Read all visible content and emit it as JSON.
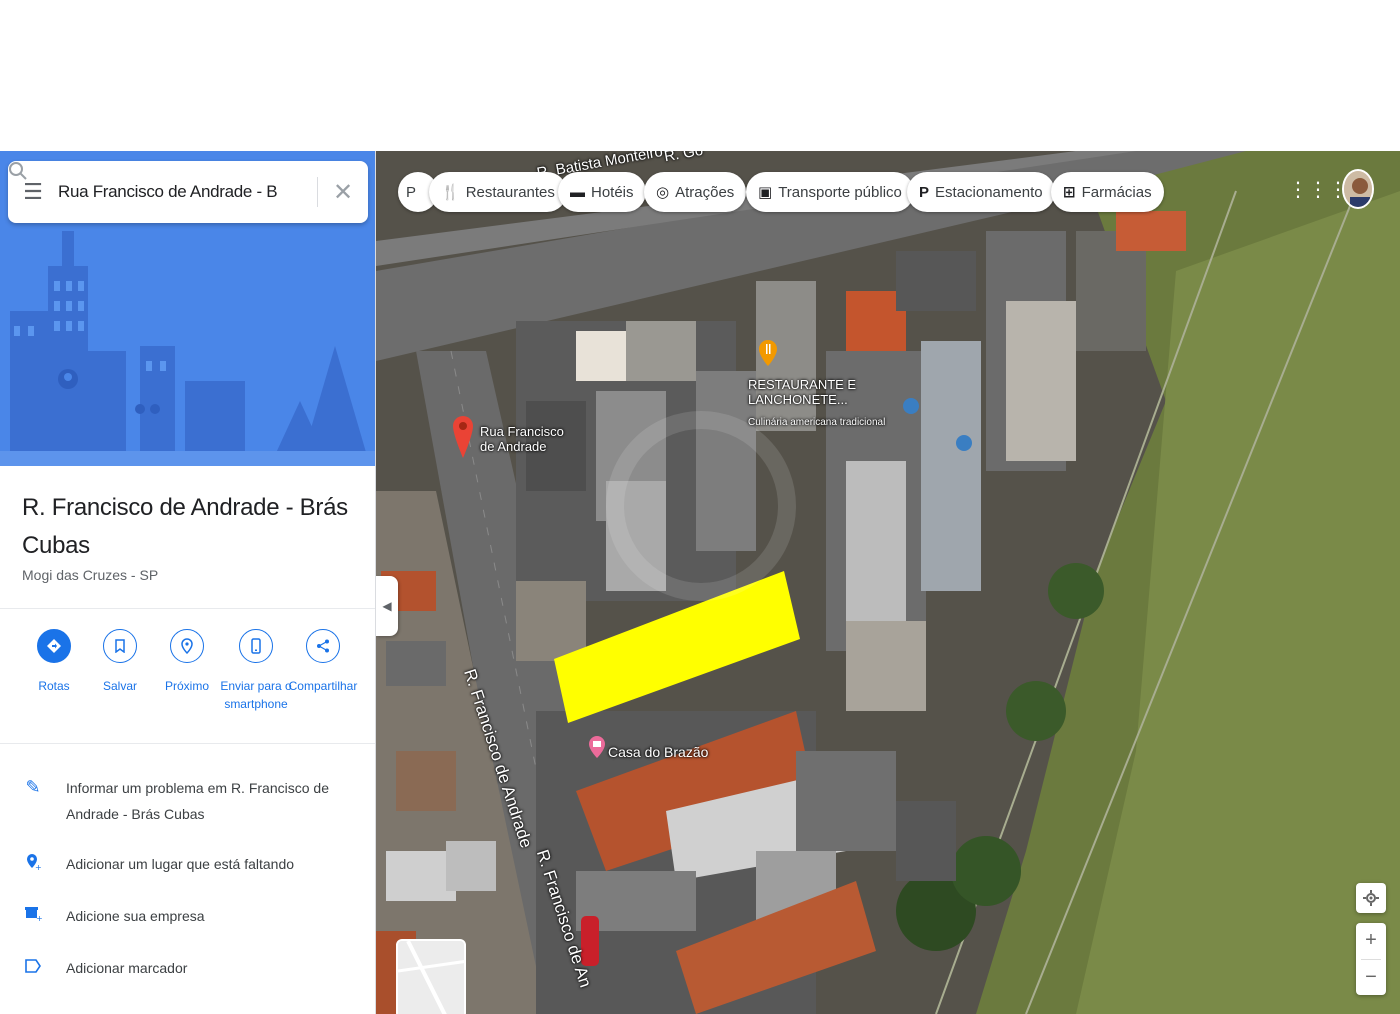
{
  "search": {
    "query": "Rua Francisco de Andrade - Brás"
  },
  "place": {
    "title": "R. Francisco de Andrade - Brás Cubas",
    "subtitle": "Mogi das Cruzes - SP"
  },
  "actions": [
    {
      "label": "Rotas",
      "icon": "directions-icon"
    },
    {
      "label": "Salvar",
      "icon": "bookmark-icon"
    },
    {
      "label": "Próximo",
      "icon": "nearby-icon"
    },
    {
      "label": "Enviar para o smartphone",
      "icon": "phone-icon"
    },
    {
      "label": "Compartilhar",
      "icon": "share-icon"
    }
  ],
  "menu": [
    {
      "label": "Informar um problema em R. Francisco de Andrade - Brás Cubas",
      "icon": "pencil-icon"
    },
    {
      "label": "Adicionar um lugar que está faltando",
      "icon": "add-place-icon"
    },
    {
      "label": "Adicione sua empresa",
      "icon": "store-icon"
    },
    {
      "label": "Adicionar marcador",
      "icon": "label-icon"
    }
  ],
  "chips": [
    {
      "label": "Restaurantes",
      "icon": "restaurant-icon"
    },
    {
      "label": "Hotéis",
      "icon": "hotel-icon"
    },
    {
      "label": "Atrações",
      "icon": "attractions-icon"
    },
    {
      "label": "Transporte público",
      "icon": "transit-icon"
    },
    {
      "label": "Estacionamento",
      "icon": "parking-icon"
    },
    {
      "label": "Farmácias",
      "icon": "pharmacy-icon"
    }
  ],
  "map": {
    "partial_chip": "P",
    "street_top_1": "R. Batista Monteiro",
    "street_top_2": "R. Go",
    "pin_label": "Rua Francisco de Andrade",
    "street_vertical_1": "R. Francisco de Andrade",
    "street_vertical_2": "R. Francisco de An",
    "restaurant_name": "RESTAURANTE E LANCHONETE...",
    "restaurant_sub": "Culinária americana tradicional",
    "poi_name": "Casa do Brazão",
    "highlight_color": "#ffff00"
  }
}
